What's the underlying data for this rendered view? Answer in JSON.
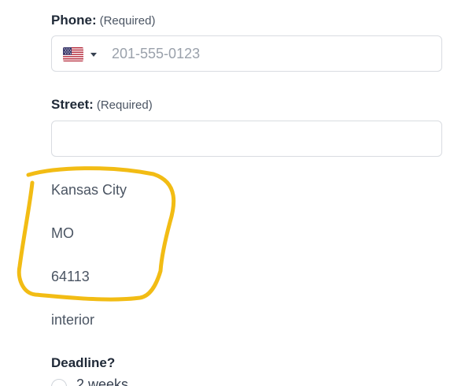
{
  "form": {
    "phone": {
      "label": "Phone:",
      "required": "(Required)",
      "country_flag": "us-flag-icon",
      "value": "201-555-0123"
    },
    "street": {
      "label": "Street:",
      "required": "(Required)",
      "value": ""
    },
    "address": {
      "city": "Kansas City",
      "state": "MO",
      "zip": "64113",
      "type": "interior"
    },
    "deadline": {
      "label": "Deadline?",
      "first_option": "2 weeks"
    }
  },
  "colors": {
    "highlight": "#f2bc14",
    "border": "#d9dce1",
    "placeholder": "#9aa1ab"
  }
}
